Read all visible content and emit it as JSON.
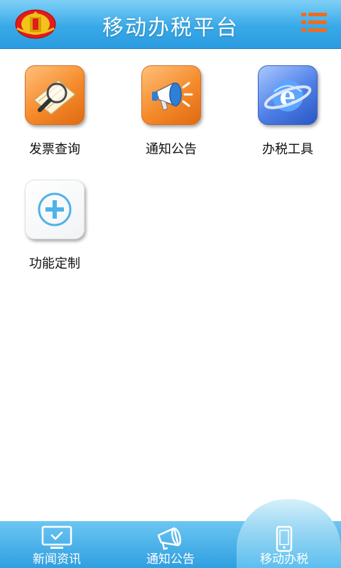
{
  "header": {
    "title": "移动办税平台",
    "logo_icon": "tax-emblem-icon",
    "menu_icon": "menu-list-icon",
    "accent_color": "#38a9e8"
  },
  "grid": {
    "items": [
      {
        "label": "发票查询",
        "icon": "magnifier-document-icon",
        "color": "#f58a2a"
      },
      {
        "label": "通知公告",
        "icon": "megaphone-icon",
        "color": "#f58a2a"
      },
      {
        "label": "办税工具",
        "icon": "internet-explorer-icon",
        "color": "#4d7fe6"
      },
      {
        "label": "功能定制",
        "icon": "plus-circle-icon",
        "color": "#4fb3e8"
      }
    ]
  },
  "tabbar": {
    "tabs": [
      {
        "label": "新闻资讯",
        "icon": "monitor-check-icon"
      },
      {
        "label": "通知公告",
        "icon": "megaphone-outline-icon"
      },
      {
        "label": "移动办税",
        "icon": "mobile-phone-icon",
        "active": true
      }
    ]
  }
}
